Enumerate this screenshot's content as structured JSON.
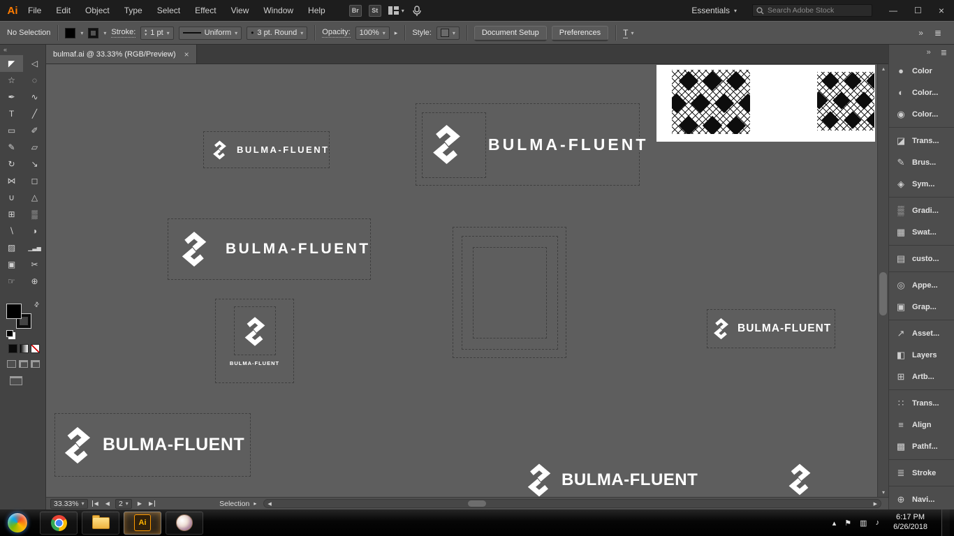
{
  "colors": {
    "brand_orange": "#ff7c00",
    "canvas_gray": "#5e5e5e",
    "logo_white": "#ffffff",
    "ui_dark": "#1d1d1d"
  },
  "icons": {
    "chevron_down": "▾",
    "chevron_up": "▴",
    "collapse_left": "«",
    "collapse_right": "»",
    "panel_menu": "≣",
    "swap_arrows": "⇄",
    "arrow_left": "◀",
    "arrow_right": "▶",
    "arrow_up": "▴",
    "arrow_down": "▾",
    "flyout_right": "▸"
  },
  "menu_bar": {
    "app_badge": "Ai",
    "items": [
      "File",
      "Edit",
      "Object",
      "Type",
      "Select",
      "Effect",
      "View",
      "Window",
      "Help"
    ],
    "bridge_badge": "Br",
    "stock_badge": "St",
    "workspace_label": "Essentials",
    "search_placeholder": "Search Adobe Stock",
    "window_buttons": {
      "minimize": "—",
      "restore": "☐",
      "close": "×"
    }
  },
  "control_bar": {
    "selection_status": "No Selection",
    "stroke_label": "Stroke:",
    "stroke_value": "1 pt",
    "width_profile": "Uniform",
    "brush_dot": "•",
    "brush_name": "3 pt. Round",
    "opacity_label": "Opacity:",
    "opacity_value": "100%",
    "style_label": "Style:",
    "document_setup_button": "Document Setup",
    "preferences_button": "Preferences",
    "type_options_glyph": "T"
  },
  "document_tab": {
    "title": "bulmaf.ai @ 33.33% (RGB/Preview)",
    "close_glyph": "×"
  },
  "tools": [
    {
      "name": "selection-tool",
      "glyph": "◤",
      "active": true
    },
    {
      "name": "direct-selection-tool",
      "glyph": "◁"
    },
    {
      "name": "magic-wand-tool",
      "glyph": "☆"
    },
    {
      "name": "lasso-tool",
      "glyph": "◌"
    },
    {
      "name": "pen-tool",
      "glyph": "✒"
    },
    {
      "name": "curvature-tool",
      "glyph": "∿"
    },
    {
      "name": "type-tool",
      "glyph": "T"
    },
    {
      "name": "line-segment-tool",
      "glyph": "╱"
    },
    {
      "name": "rectangle-tool",
      "glyph": "▭"
    },
    {
      "name": "paintbrush-tool",
      "glyph": "✐"
    },
    {
      "name": "shaper-tool",
      "glyph": "✎"
    },
    {
      "name": "eraser-tool",
      "glyph": "▱"
    },
    {
      "name": "rotate-tool",
      "glyph": "↻"
    },
    {
      "name": "scale-tool",
      "glyph": "↘"
    },
    {
      "name": "width-tool",
      "glyph": "⋈"
    },
    {
      "name": "free-transform-tool",
      "glyph": "◻"
    },
    {
      "name": "shape-builder-tool",
      "glyph": "∪"
    },
    {
      "name": "perspective-grid-tool",
      "glyph": "△"
    },
    {
      "name": "mesh-tool",
      "glyph": "⊞"
    },
    {
      "name": "gradient-tool",
      "glyph": "▒"
    },
    {
      "name": "eyedropper-tool",
      "glyph": "∖"
    },
    {
      "name": "blend-tool",
      "glyph": "◑"
    },
    {
      "name": "symbol-sprayer-tool",
      "glyph": "▨"
    },
    {
      "name": "column-graph-tool",
      "glyph": "▁▃▅"
    },
    {
      "name": "artboard-tool",
      "glyph": "▣"
    },
    {
      "name": "slice-tool",
      "glyph": "✂"
    },
    {
      "name": "hand-tool",
      "glyph": "☞"
    },
    {
      "name": "zoom-tool",
      "glyph": "⊕"
    }
  ],
  "right_panel": {
    "items": [
      {
        "label": "Color",
        "glyph": "●",
        "sep": false
      },
      {
        "label": "Color...",
        "glyph": "◐",
        "sep": false
      },
      {
        "label": "Color...",
        "glyph": "◉",
        "sep": true
      },
      {
        "label": "Trans...",
        "glyph": "◪",
        "sep": false
      },
      {
        "label": "Brus...",
        "glyph": "✎",
        "sep": false
      },
      {
        "label": "Sym...",
        "glyph": "◈",
        "sep": true
      },
      {
        "label": "Gradi...",
        "glyph": "▒",
        "sep": false
      },
      {
        "label": "Swat...",
        "glyph": "▦",
        "sep": true
      },
      {
        "label": "custo...",
        "glyph": "▤",
        "sep": true
      },
      {
        "label": "Appe...",
        "glyph": "◎",
        "sep": false
      },
      {
        "label": "Grap...",
        "glyph": "▣",
        "sep": true
      },
      {
        "label": "Asset...",
        "glyph": "↗",
        "sep": false
      },
      {
        "label": "Layers",
        "glyph": "◧",
        "sep": false
      },
      {
        "label": "Artb...",
        "glyph": "⊞",
        "sep": true
      },
      {
        "label": "Trans...",
        "glyph": "∷",
        "sep": false
      },
      {
        "label": "Align",
        "glyph": "≡",
        "sep": false
      },
      {
        "label": "Pathf...",
        "glyph": "▩",
        "sep": true
      },
      {
        "label": "Stroke",
        "glyph": "≣",
        "sep": true
      },
      {
        "label": "Navi...",
        "glyph": "⊕",
        "sep": false
      }
    ]
  },
  "canvas": {
    "logos": [
      {
        "text": "BULMA-FLUENT"
      },
      {
        "text": "BULMA-FLUENT"
      },
      {
        "text": "BULMA-FLUENT"
      },
      {
        "text": "BULMA-FLUENT"
      },
      {
        "text": "BULMA-FLUENT"
      },
      {
        "text": "BULMA-FLUENT"
      },
      {
        "text": "BULMA-FLUENT"
      }
    ]
  },
  "status_bar": {
    "zoom": "33.33%",
    "artboard_number": "2",
    "status_text": "Selection"
  },
  "taskbar": {
    "ai_badge": "Ai",
    "tray": [
      {
        "name": "tray-expand-icon",
        "glyph": "▴"
      },
      {
        "name": "action-center-flag-icon",
        "glyph": "⚑"
      },
      {
        "name": "display-icon",
        "glyph": "▥"
      },
      {
        "name": "volume-icon",
        "glyph": "♪"
      }
    ],
    "time": "6:17 PM",
    "date": "6/26/2018"
  }
}
